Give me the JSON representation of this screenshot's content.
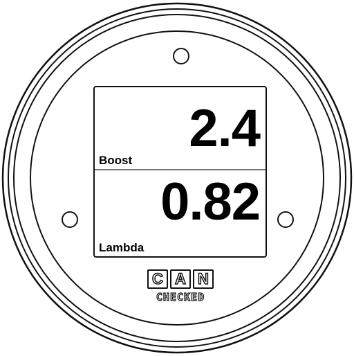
{
  "gauge": {
    "readouts": [
      {
        "label": "Boost",
        "value": "2.4"
      },
      {
        "label": "Lambda",
        "value": "0.82"
      }
    ],
    "logo": {
      "letters": [
        "C",
        "A",
        "N"
      ],
      "subtitle": "CHECKED"
    },
    "colors": {
      "outline": "#111111",
      "background": "#ffffff",
      "divider": "#777777"
    }
  }
}
